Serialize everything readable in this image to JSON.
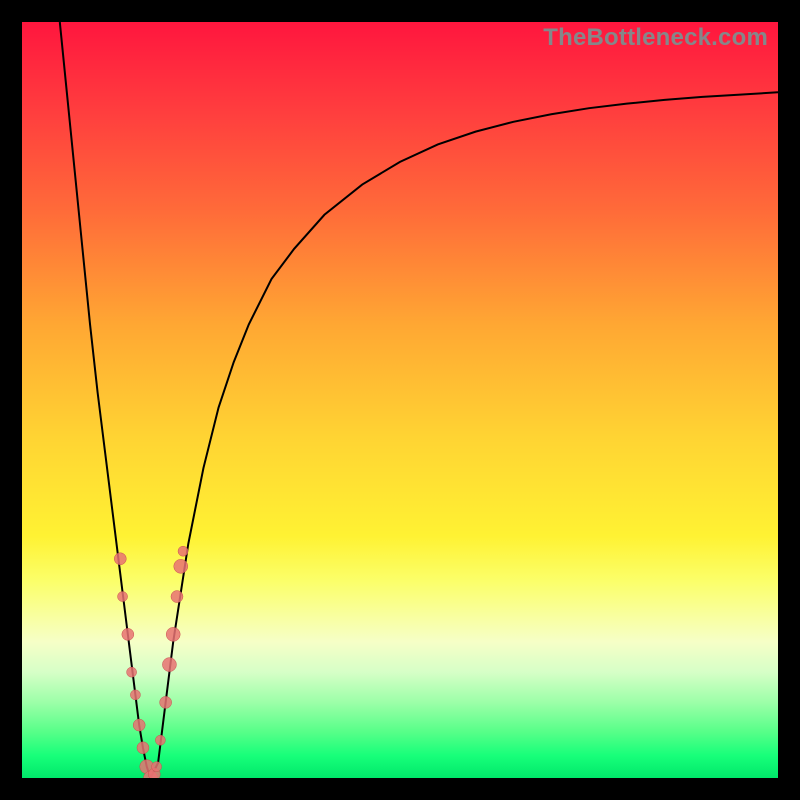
{
  "watermark": "TheBottleneck.com",
  "colors": {
    "background_frame": "#000000",
    "curve_stroke": "#000000",
    "marker_fill": "#e77272",
    "marker_stroke": "#c94f4f",
    "watermark_text": "#85878a"
  },
  "chart_data": {
    "type": "line",
    "title": "",
    "xlabel": "",
    "ylabel": "",
    "xlim": [
      0,
      100
    ],
    "ylim": [
      0,
      100
    ],
    "grid": false,
    "legend": null,
    "series": [
      {
        "name": "bottleneck-curve",
        "x": [
          5,
          6,
          7,
          8,
          9,
          10,
          11,
          12,
          13,
          13.5,
          14,
          14.5,
          15,
          15.5,
          16,
          16.5,
          17,
          18,
          19,
          20,
          22,
          24,
          26,
          28,
          30,
          33,
          36,
          40,
          45,
          50,
          55,
          60,
          65,
          70,
          75,
          80,
          85,
          90,
          95,
          100
        ],
        "y": [
          100,
          90,
          80,
          70,
          60,
          51,
          43,
          35,
          27,
          23,
          19,
          15,
          11,
          7,
          4,
          1.5,
          0,
          2,
          10,
          18,
          31,
          41,
          49,
          55,
          60,
          66,
          70,
          74.5,
          78.5,
          81.5,
          83.8,
          85.5,
          86.8,
          87.8,
          88.6,
          89.2,
          89.7,
          90.1,
          90.4,
          90.7
        ]
      }
    ],
    "markers": [
      {
        "x": 13.0,
        "y": 29,
        "r": 6
      },
      {
        "x": 13.3,
        "y": 24,
        "r": 5
      },
      {
        "x": 14.0,
        "y": 19,
        "r": 6
      },
      {
        "x": 14.5,
        "y": 14,
        "r": 5
      },
      {
        "x": 15.0,
        "y": 11,
        "r": 5
      },
      {
        "x": 15.5,
        "y": 7,
        "r": 6
      },
      {
        "x": 16.0,
        "y": 4,
        "r": 6
      },
      {
        "x": 16.5,
        "y": 1.5,
        "r": 7
      },
      {
        "x": 17.0,
        "y": 0,
        "r": 7
      },
      {
        "x": 17.5,
        "y": 0.5,
        "r": 6
      },
      {
        "x": 17.8,
        "y": 1.5,
        "r": 5
      },
      {
        "x": 18.3,
        "y": 5,
        "r": 5
      },
      {
        "x": 19.0,
        "y": 10,
        "r": 6
      },
      {
        "x": 19.5,
        "y": 15,
        "r": 7
      },
      {
        "x": 20.0,
        "y": 19,
        "r": 7
      },
      {
        "x": 20.5,
        "y": 24,
        "r": 6
      },
      {
        "x": 21.0,
        "y": 28,
        "r": 7
      },
      {
        "x": 21.3,
        "y": 30,
        "r": 5
      }
    ],
    "gradient_stops": [
      {
        "pos": 0.0,
        "color": "#ff163e"
      },
      {
        "pos": 0.12,
        "color": "#ff3e3e"
      },
      {
        "pos": 0.25,
        "color": "#ff6b39"
      },
      {
        "pos": 0.4,
        "color": "#ffa733"
      },
      {
        "pos": 0.55,
        "color": "#ffd433"
      },
      {
        "pos": 0.68,
        "color": "#fff233"
      },
      {
        "pos": 0.74,
        "color": "#fbff6a"
      },
      {
        "pos": 0.82,
        "color": "#f6ffc7"
      },
      {
        "pos": 0.86,
        "color": "#d6ffc7"
      },
      {
        "pos": 0.9,
        "color": "#9cffa8"
      },
      {
        "pos": 0.94,
        "color": "#55ff88"
      },
      {
        "pos": 0.97,
        "color": "#18ff7a"
      },
      {
        "pos": 1.0,
        "color": "#00e86a"
      }
    ]
  }
}
